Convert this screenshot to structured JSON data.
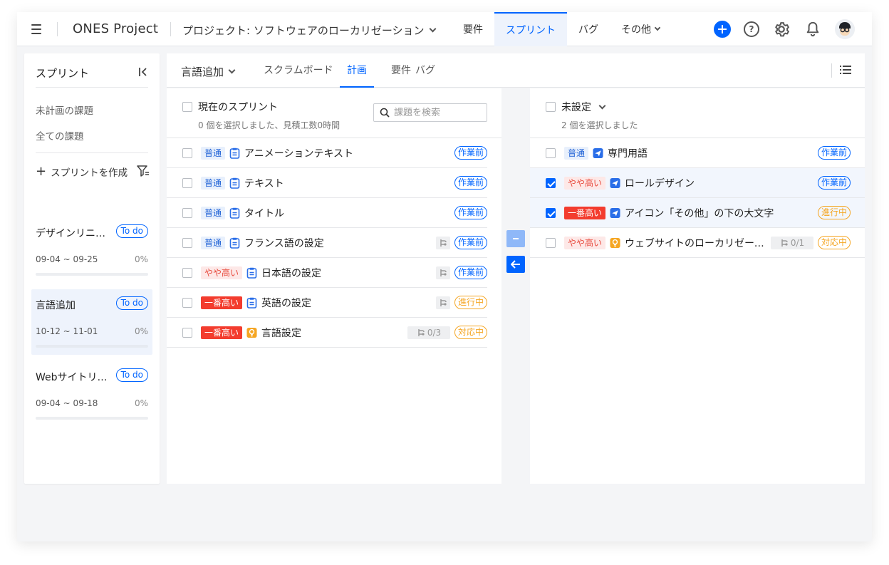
{
  "topbar": {
    "brand": "ONES Project",
    "project": "プロジェクト: ソフトウェアのローカリゼーション",
    "nav": [
      {
        "label": "要件",
        "active": false
      },
      {
        "label": "スプリント",
        "active": true
      },
      {
        "label": "バグ",
        "active": false
      },
      {
        "label": "その他",
        "active": false
      }
    ]
  },
  "sidebar": {
    "title": "スプリント",
    "links": [
      "未計画の課題",
      "全ての課題"
    ],
    "create": "スプリントを作成",
    "sprints": [
      {
        "name": "デザインリニューアル",
        "status": "To do",
        "dates": "09-04 ~ 09-25",
        "progress": "0%"
      },
      {
        "name": "言語追加",
        "status": "To do",
        "dates": "10-12 ~ 11-01",
        "progress": "0%"
      },
      {
        "name": "Webサイトリニューアル",
        "status": "To do",
        "dates": "09-04 ~ 09-18",
        "progress": "0%"
      }
    ]
  },
  "main": {
    "version": "言語追加",
    "tabs": [
      {
        "label": "スクラムボード",
        "active": false
      },
      {
        "label": "計画",
        "active": true
      },
      {
        "label": "要件",
        "active": false
      },
      {
        "label": "バグ",
        "active": false
      }
    ],
    "left": {
      "title": "現在のスプリント",
      "subtitle": "0 個を選択しました、見積工数0時間",
      "search_placeholder": "課題を検索",
      "rows": [
        {
          "priority": "普通",
          "prio": "normal",
          "type": "doc",
          "title": "アニメーションテキスト",
          "sub": "",
          "status": "作業前",
          "statusColor": "blue",
          "checked": false
        },
        {
          "priority": "普通",
          "prio": "normal",
          "type": "doc",
          "title": "テキスト",
          "sub": "",
          "status": "作業前",
          "statusColor": "blue",
          "checked": false
        },
        {
          "priority": "普通",
          "prio": "normal",
          "type": "doc",
          "title": "タイトル",
          "sub": "",
          "status": "作業前",
          "statusColor": "blue",
          "checked": false
        },
        {
          "priority": "普通",
          "prio": "normal",
          "type": "doc",
          "title": "フランス語の設定",
          "sub": "icon",
          "status": "作業前",
          "statusColor": "blue",
          "checked": false
        },
        {
          "priority": "やや高い",
          "prio": "high",
          "type": "doc",
          "title": "日本語の設定",
          "sub": "icon",
          "status": "作業前",
          "statusColor": "blue",
          "checked": false
        },
        {
          "priority": "一番高い",
          "prio": "highest",
          "type": "doc",
          "title": "英語の設定",
          "sub": "icon",
          "status": "進行中",
          "statusColor": "orange",
          "checked": false
        },
        {
          "priority": "一番高い",
          "prio": "highest",
          "type": "idea",
          "title": "言語設定",
          "sub": "0/3",
          "status": "対応中",
          "statusColor": "orange",
          "checked": false
        }
      ]
    },
    "right": {
      "title": "未設定",
      "subtitle": "2 個を選択しました",
      "rows": [
        {
          "priority": "普通",
          "prio": "normal",
          "type": "task",
          "title": "専門用語",
          "sub": "",
          "status": "作業前",
          "statusColor": "blue",
          "checked": false
        },
        {
          "priority": "やや高い",
          "prio": "high",
          "type": "task",
          "title": "ロールデザイン",
          "sub": "",
          "status": "作業前",
          "statusColor": "blue",
          "checked": true
        },
        {
          "priority": "一番高い",
          "prio": "highest",
          "type": "task",
          "title": "アイコン「その他」の下の大文字",
          "sub": "",
          "status": "進行中",
          "statusColor": "orange",
          "checked": true
        },
        {
          "priority": "やや高い",
          "prio": "high",
          "type": "idea",
          "title": "ウェブサイトのローカリゼーション",
          "sub": "0/1",
          "status": "対応中",
          "statusColor": "orange",
          "checked": false
        }
      ]
    }
  },
  "colors": {
    "accent": "#0064ff",
    "orange": "#f5a623",
    "red": "#f33c2e"
  }
}
